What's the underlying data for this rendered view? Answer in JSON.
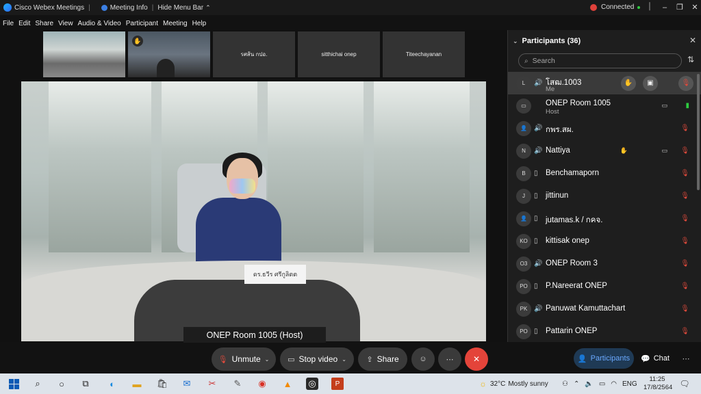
{
  "titlebar": {
    "app_name": "Cisco Webex Meetings",
    "meeting_info": "Meeting Info",
    "hide_menu_bar": "Hide Menu Bar",
    "connection_status": "Connected",
    "separator": "|"
  },
  "menu": [
    "File",
    "Edit",
    "Share",
    "View",
    "Audio & Video",
    "Participant",
    "Meeting",
    "Help"
  ],
  "thumbnails": [
    {
      "label": ""
    },
    {
      "label": ""
    },
    {
      "label": "รศส้น กปอ."
    },
    {
      "label": "sitthichai onep"
    },
    {
      "label": "Titeechayanan"
    }
  ],
  "active_speaker": {
    "label": "ONEP Room 1005 (Host)",
    "nameplate": "ดร.ธวีร ศรีกูลิตต"
  },
  "controls": {
    "unmute": "Unmute",
    "stop_video": "Stop video",
    "share": "Share"
  },
  "panel": {
    "title": "Participants (36)",
    "search_placeholder": "Search",
    "participants": [
      {
        "initials": "L",
        "name": "โสฒ.1003",
        "role": "Me",
        "audio": "🔊",
        "mic": "off",
        "cam": false,
        "hand": false,
        "me": true
      },
      {
        "initials": "▭",
        "name": "ONEP Room 1005",
        "role": "Host",
        "audio": "",
        "mic": "on",
        "cam": true,
        "hand": false,
        "me": false
      },
      {
        "initials": "👤",
        "name": "กพร.สผ.",
        "role": "",
        "audio": "🔊",
        "mic": "off",
        "cam": false,
        "hand": false,
        "me": false
      },
      {
        "initials": "N",
        "name": "Nattiya",
        "role": "",
        "audio": "🔊",
        "mic": "off",
        "cam": true,
        "hand": true,
        "me": false
      },
      {
        "initials": "B",
        "name": "Benchamaporn",
        "role": "",
        "audio": "▯",
        "mic": "off",
        "cam": false,
        "hand": false,
        "me": false
      },
      {
        "initials": "J",
        "name": "jittinun",
        "role": "",
        "audio": "▯",
        "mic": "off",
        "cam": false,
        "hand": false,
        "me": false
      },
      {
        "initials": "👤",
        "name": "jutamas.k / กคจ.",
        "role": "",
        "audio": "▯",
        "mic": "off",
        "cam": false,
        "hand": false,
        "me": false
      },
      {
        "initials": "KO",
        "name": "kittisak onep",
        "role": "",
        "audio": "▯",
        "mic": "off",
        "cam": false,
        "hand": false,
        "me": false
      },
      {
        "initials": "O3",
        "name": "ONEP Room 3",
        "role": "",
        "audio": "🔊",
        "mic": "off",
        "cam": false,
        "hand": false,
        "me": false
      },
      {
        "initials": "PO",
        "name": "P.Nareerat ONEP",
        "role": "",
        "audio": "▯",
        "mic": "off",
        "cam": false,
        "hand": false,
        "me": false
      },
      {
        "initials": "PK",
        "name": "Panuwat Kamuttachart",
        "role": "",
        "audio": "🔊",
        "mic": "off",
        "cam": false,
        "hand": false,
        "me": false
      },
      {
        "initials": "PO",
        "name": "Pattarin ONEP",
        "role": "",
        "audio": "▯",
        "mic": "off",
        "cam": false,
        "hand": false,
        "me": false
      }
    ],
    "participants_tab": "Participants",
    "chat_tab": "Chat"
  },
  "taskbar": {
    "weather_temp": "32°C",
    "weather_desc": "Mostly sunny",
    "language": "ENG",
    "time": "11:25",
    "date": "17/8/2564"
  },
  "colors": {
    "mute_red": "#e04a3c",
    "unmute_green": "#2ecc40",
    "leave_red": "#e4443a",
    "accent_blue": "#6aa9ff"
  }
}
